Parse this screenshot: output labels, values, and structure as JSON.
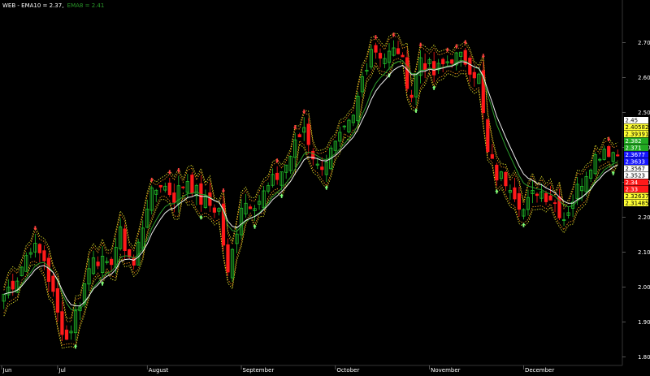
{
  "header": {
    "symbol": "WEB",
    "ema10_text": "EMA10 = 2.37,",
    "ema8_text": "EMA8 = 2.41"
  },
  "colors": {
    "background": "#000000",
    "up": "#22c02a",
    "down": "#ff1a1a",
    "ema10": "#f0f0f0",
    "ema8": "#2a9a2a",
    "envelope_orange": "#ff9a1a",
    "envelope_yellow": "#e8e82a",
    "text": "#ffffff"
  },
  "chart_data": {
    "type": "candlestick",
    "title": "WEB - EMA10 = 2.37, EMA8 = 2.41",
    "xlabel": "",
    "ylabel": "",
    "ylim": [
      1.78,
      2.79
    ],
    "yticks": [
      "2.700",
      "2.600",
      "2.500",
      "2.400",
      "2.300",
      "2.200",
      "2.100",
      "2.000",
      "1.900",
      "1.800"
    ],
    "ytick_values": [
      2.7,
      2.6,
      2.5,
      2.4,
      2.3,
      2.2,
      2.1,
      2.0,
      1.9,
      1.8
    ],
    "months": [
      "Jun",
      "Jul",
      "August",
      "September",
      "October",
      "November",
      "December"
    ],
    "month_start_index": [
      0,
      12,
      32,
      53,
      74,
      95,
      116
    ],
    "n_bars": 138,
    "waypoints": [
      [
        0,
        1.98
      ],
      [
        3,
        2.03
      ],
      [
        6,
        2.12
      ],
      [
        9,
        2.08
      ],
      [
        12,
        1.92
      ],
      [
        14,
        1.85
      ],
      [
        17,
        1.96
      ],
      [
        20,
        2.1
      ],
      [
        23,
        2.05
      ],
      [
        26,
        2.15
      ],
      [
        29,
        2.06
      ],
      [
        32,
        2.24
      ],
      [
        35,
        2.3
      ],
      [
        38,
        2.26
      ],
      [
        41,
        2.31
      ],
      [
        44,
        2.25
      ],
      [
        48,
        2.22
      ],
      [
        50,
        2.03
      ],
      [
        53,
        2.24
      ],
      [
        57,
        2.25
      ],
      [
        60,
        2.3
      ],
      [
        63,
        2.35
      ],
      [
        67,
        2.46
      ],
      [
        70,
        2.34
      ],
      [
        74,
        2.4
      ],
      [
        78,
        2.48
      ],
      [
        80,
        2.6
      ],
      [
        82,
        2.69
      ],
      [
        85,
        2.66
      ],
      [
        88,
        2.68
      ],
      [
        91,
        2.55
      ],
      [
        93,
        2.66
      ],
      [
        96,
        2.61
      ],
      [
        100,
        2.66
      ],
      [
        103,
        2.65
      ],
      [
        106,
        2.6
      ],
      [
        108,
        2.38
      ],
      [
        110,
        2.32
      ],
      [
        113,
        2.3
      ],
      [
        116,
        2.22
      ],
      [
        119,
        2.28
      ],
      [
        122,
        2.26
      ],
      [
        125,
        2.2
      ],
      [
        128,
        2.28
      ],
      [
        131,
        2.36
      ],
      [
        134,
        2.4
      ],
      [
        137,
        2.38
      ]
    ],
    "series": [
      {
        "name": "EMA10",
        "last": 2.37
      },
      {
        "name": "EMA8",
        "last": 2.41
      }
    ],
    "price_labels": [
      {
        "value": "2.45",
        "bg": "#ffffff",
        "fg": "#000000"
      },
      {
        "value": "2.40582",
        "bg": "#ffff33",
        "fg": "#000000"
      },
      {
        "value": "2.39391",
        "bg": "#ffff33",
        "fg": "#000000"
      },
      {
        "value": "2.382",
        "bg": "#22aa22",
        "fg": "#ffffff"
      },
      {
        "value": "2.371",
        "bg": "#22aa22",
        "fg": "#ffffff"
      },
      {
        "value": "2.3677",
        "bg": "#1515ff",
        "fg": "#ffffff"
      },
      {
        "value": "2.3633",
        "bg": "#1515ff",
        "fg": "#ffffff"
      },
      {
        "value": "2.3567",
        "bg": "#ffffff",
        "fg": "#000000"
      },
      {
        "value": "2.3523",
        "bg": "#ffffff",
        "fg": "#000000"
      },
      {
        "value": "2.34",
        "bg": "#ff1a1a",
        "fg": "#ffffff"
      },
      {
        "value": "2.33",
        "bg": "#ff1a1a",
        "fg": "#ffffff"
      },
      {
        "value": "2.32637",
        "bg": "#ffff33",
        "fg": "#000000"
      },
      {
        "value": "2.31485",
        "bg": "#ffff33",
        "fg": "#000000"
      }
    ]
  }
}
